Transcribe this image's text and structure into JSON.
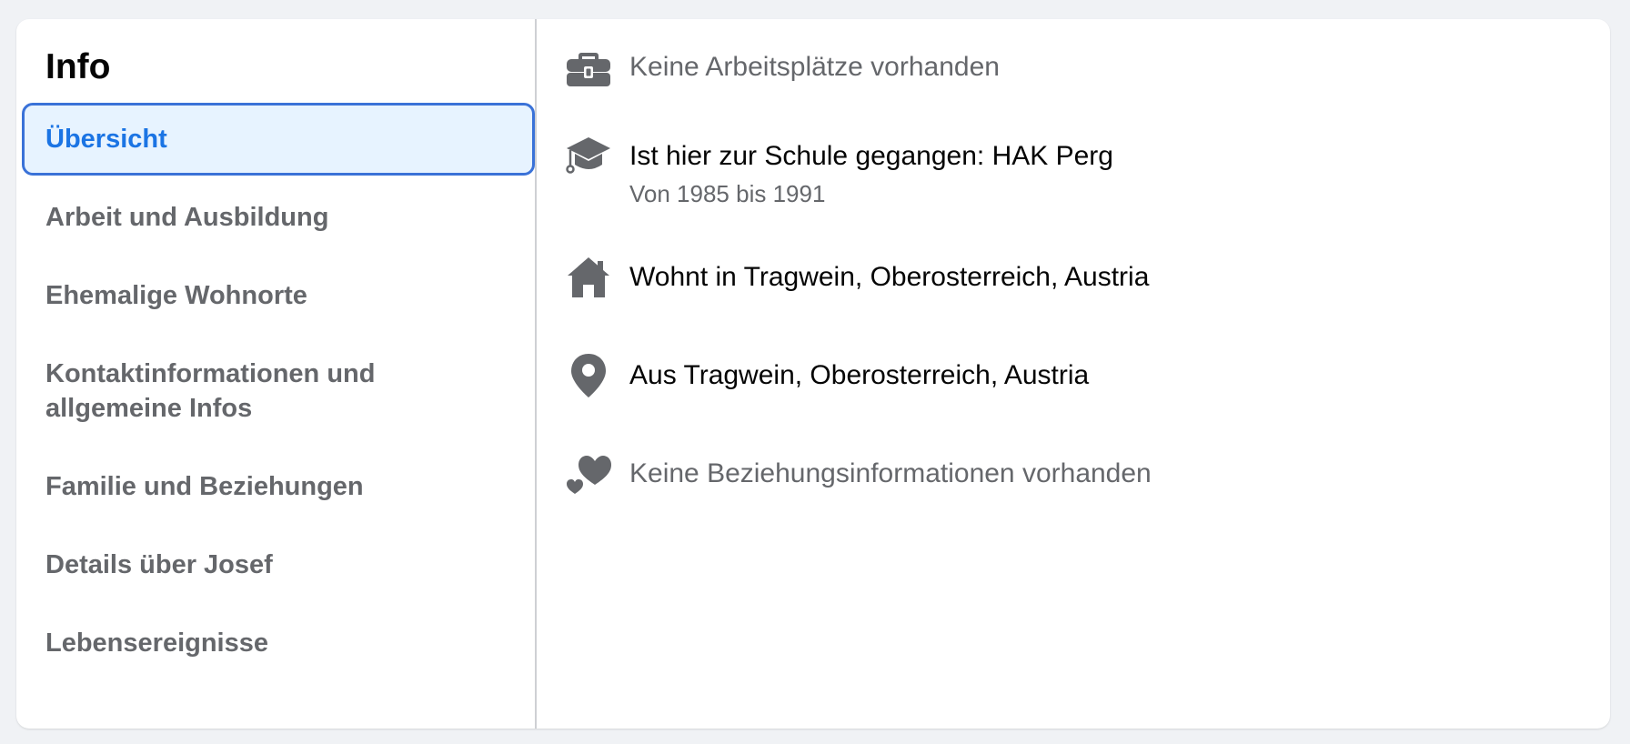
{
  "sidebar": {
    "title": "Info",
    "items": [
      {
        "label": "Übersicht"
      },
      {
        "label": "Arbeit und Ausbildung"
      },
      {
        "label": "Ehemalige Wohnorte"
      },
      {
        "label": "Kontaktinformationen und allgemeine Infos"
      },
      {
        "label": "Familie und Beziehungen"
      },
      {
        "label": "Details über Josef"
      },
      {
        "label": "Lebensereignisse"
      }
    ]
  },
  "overview": {
    "work": {
      "icon": "briefcase-icon",
      "text": "Keine Arbeitsplätze vorhanden"
    },
    "education": {
      "icon": "graduation-cap-icon",
      "text": "Ist hier zur Schule gegangen: HAK Perg",
      "subtext": "Von 1985 bis 1991"
    },
    "lives_in": {
      "icon": "home-icon",
      "text": "Wohnt in Tragwein, Oberosterreich, Austria"
    },
    "from": {
      "icon": "location-pin-icon",
      "text": "Aus Tragwein, Oberosterreich, Austria"
    },
    "relationship": {
      "icon": "hearts-icon",
      "text": "Keine Beziehungsinformationen vorhanden"
    }
  },
  "colors": {
    "accent": "#1b74e4",
    "active_bg": "#e7f3ff",
    "active_border": "#3a72d8",
    "muted_text": "#65676b",
    "icon": "#65676b"
  }
}
